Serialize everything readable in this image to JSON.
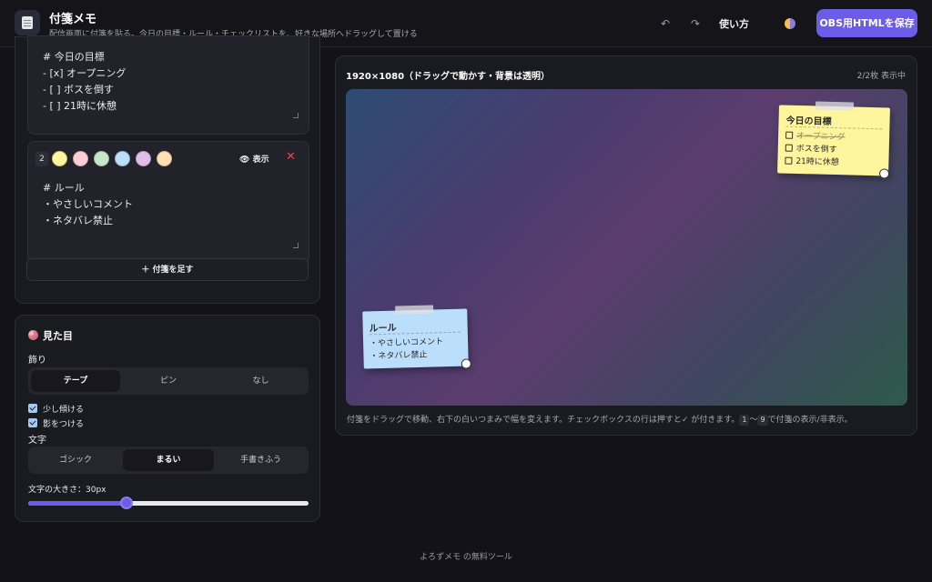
{
  "header": {
    "title": "付箋メモ",
    "subtitle": "配信画面に付箋を貼る。今日の目標・ルール・チェックリストを、好きな場所へドラッグして置ける",
    "howto_label": "使い方",
    "save_label": "OBS用HTMLを保存"
  },
  "notes": [
    {
      "text": "# 今日の目標\n- [x] オープニング\n- [ ] ボスを倒す\n- [ ] 21時に休憩"
    },
    {
      "index": "2",
      "colors": [
        "#fff59d",
        "#ffcdd2",
        "#c8e6c9",
        "#bbdefb",
        "#e1bee7",
        "#ffe0b2"
      ],
      "show_label": "表示",
      "close_label": "✕",
      "text": "# ルール\n・やさしいコメント\n・ネタバレ禁止"
    }
  ],
  "add_note_label": "＋ 付箋を足す",
  "appearance": {
    "title": "見た目",
    "decoration_label": "飾り",
    "decoration_options": [
      "テープ",
      "ピン",
      "なし"
    ],
    "decoration_selected": "テープ",
    "tilt_label": "少し傾ける",
    "tilt_checked": true,
    "shadow_label": "影をつける",
    "shadow_checked": true,
    "font_label": "文字",
    "font_options": [
      "ゴシック",
      "まるい",
      "手書きふう"
    ],
    "font_selected": "まるい",
    "size_label": "文字の大きさ：30px",
    "size_fraction": 0.35
  },
  "preview": {
    "title": "1920×1080（ドラッグで動かす・背景は透明）",
    "count": "2/2枚 表示中",
    "hint_prefix": "付箋をドラッグで移動、右下の白いつまみで幅を変えます。チェックボックスの行は押すと✓ が付きます。",
    "key_start": "1",
    "key_sep": "〜",
    "key_end": "9",
    "hint_suffix": "で付箋の表示/非表示。",
    "sticky_goal": {
      "color": "#fff59d",
      "title": "今日の目標",
      "items": [
        "オープニング",
        "ボスを倒す",
        "21時に休憩"
      ]
    },
    "sticky_rules": {
      "color": "#bbdefb",
      "title": "ルール",
      "lines": [
        "・やさしいコメント",
        "・ネタバレ禁止"
      ]
    }
  },
  "footer": "よろずメモ の無料ツール"
}
